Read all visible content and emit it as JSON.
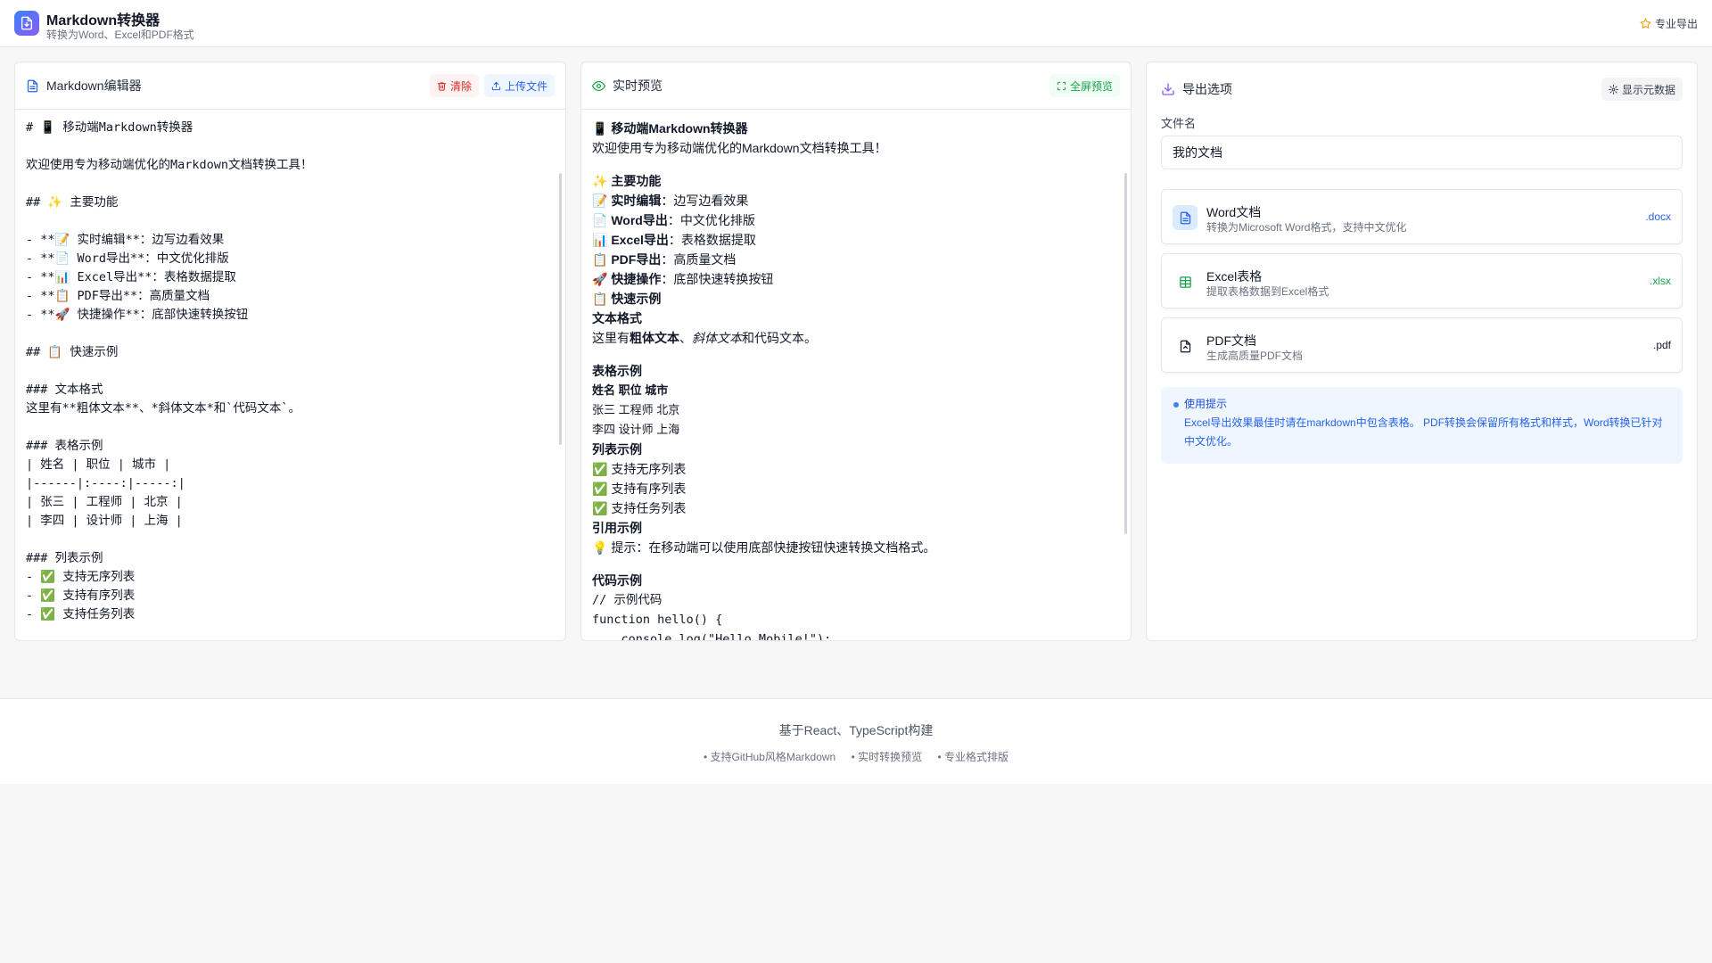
{
  "header": {
    "title": "Markdown转换器",
    "subtitle": "转换为Word、Excel和PDF格式",
    "pro_label": "专业导出"
  },
  "editor": {
    "title": "Markdown编辑器",
    "clear_label": "清除",
    "upload_label": "上传文件",
    "content": "# 📱 移动端Markdown转换器\n\n欢迎使用专为移动端优化的Markdown文档转换工具！\n\n## ✨ 主要功能\n\n- **📝 实时编辑**：边写边看效果\n- **📄 Word导出**：中文优化排版\n- **📊 Excel导出**：表格数据提取\n- **📋 PDF导出**：高质量文档\n- **🚀 快捷操作**：底部快速转换按钮\n\n## 📋 快速示例\n\n### 文本格式\n这里有**粗体文本**、*斜体文本*和`代码文本`。\n\n### 表格示例\n| 姓名 | 职位 | 城市 |\n|------|:----:|-----:|\n| 张三 | 工程师 | 北京 |\n| 李四 | 设计师 | 上海 |\n\n### 列表示例\n- ✅ 支持无序列表\n- ✅ 支持有序列表\n- ✅ 支持任务列表"
  },
  "preview": {
    "title": "实时预览",
    "fullscreen_label": "全屏预览",
    "h1": "📱 移动端Markdown转换器",
    "intro": "欢迎使用专为移动端优化的Markdown文档转换工具！",
    "features_heading": "✨ 主要功能",
    "features": [
      {
        "strong": "📝 实时编辑",
        "text": "：边写边看效果"
      },
      {
        "strong": "📄 Word导出",
        "text": "：中文优化排版"
      },
      {
        "strong": "📊 Excel导出",
        "text": "：表格数据提取"
      },
      {
        "strong": "📋 PDF导出",
        "text": "：高质量文档"
      },
      {
        "strong": "🚀 快捷操作",
        "text": "：底部快速转换按钮"
      }
    ],
    "quick_heading": "📋 快速示例",
    "text_format_heading": "文本格式",
    "text_format_prefix": "这里有",
    "text_format_bold": "粗体文本",
    "text_format_sep": "、",
    "text_format_italic": "斜体文本",
    "text_format_suffix": "和代码文本。",
    "table_heading": "表格示例",
    "table_header": "姓名  职位  城市",
    "table_rows": [
      "张三 工程师 北京",
      "李四 设计师 上海"
    ],
    "list_heading": "列表示例",
    "list_items": [
      "✅ 支持无序列表",
      "✅ 支持有序列表",
      "✅ 支持任务列表"
    ],
    "quote_heading": "引用示例",
    "quote_text": "💡 提示：在移动端可以使用底部快捷按钮快速转换文档格式。",
    "code_heading": "代码示例",
    "code_lines": [
      "// 示例代码",
      "function hello() {",
      "    console.log(\"Hello Mobile!\");"
    ]
  },
  "export": {
    "title": "导出选项",
    "metadata_label": "显示元数据",
    "filename_label": "文件名",
    "filename_value": "我的文档",
    "formats": [
      {
        "name": "Word文档",
        "desc": "转换为Microsoft Word格式，支持中文优化",
        "ext": ".docx",
        "color": "#2563eb",
        "bg": "#dbeafe",
        "icon": "word-doc-icon"
      },
      {
        "name": "Excel表格",
        "desc": "提取表格数据到Excel格式",
        "ext": ".xlsx",
        "color": "#16a34a",
        "bg": "#ffffff",
        "icon": "excel-sheet-icon"
      },
      {
        "name": "PDF文档",
        "desc": "生成高质量PDF文档",
        "ext": ".pdf",
        "color": "#111827",
        "bg": "#ffffff",
        "icon": "pdf-file-icon"
      }
    ],
    "tips_title": "使用提示",
    "tips_text": "Excel导出效果最佳时请在markdown中包含表格。 PDF转换会保留所有格式和样式，Word转换已针对中文优化。"
  },
  "footer": {
    "main": "基于React、TypeScript构建",
    "features": [
      "• 支持GitHub风格Markdown",
      "• 实时转换预览",
      "• 专业格式排版"
    ]
  },
  "colors": {
    "accent": "#3b82f6",
    "accent_purple": "#8b5cf6",
    "danger": "#dc2626",
    "success": "#16a34a"
  }
}
